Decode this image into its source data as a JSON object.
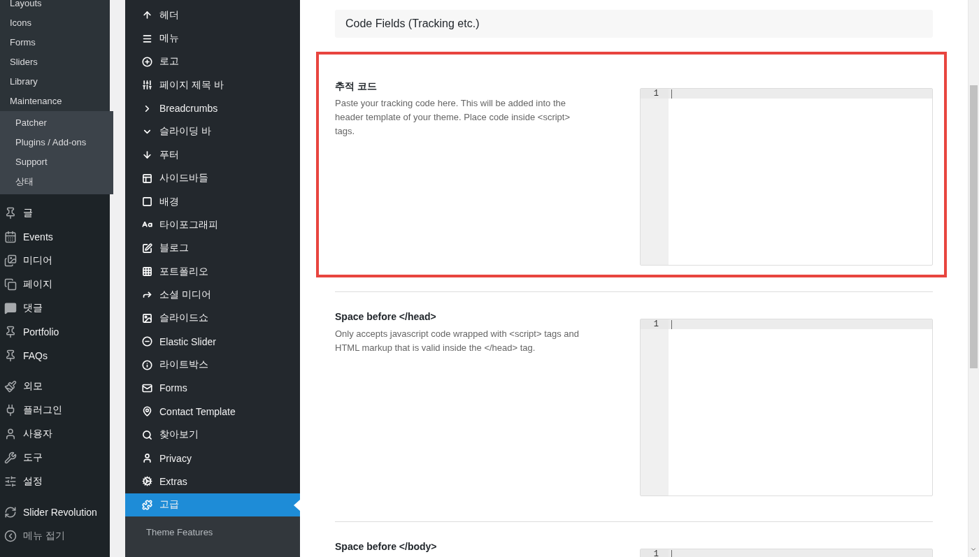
{
  "admin_menu": {
    "flyout_items": [
      "Layouts",
      "Icons",
      "Forms",
      "Sliders",
      "Library",
      "Maintenance"
    ],
    "submenu_items": [
      "Patcher",
      "Plugins / Add-ons",
      "Support",
      "상태"
    ],
    "groups": [
      [
        "글",
        "Events",
        "미디어",
        "페이지",
        "댓글",
        "Portfolio",
        "FAQs"
      ],
      [
        "외모",
        "플러그인",
        "사용자",
        "도구",
        "설정"
      ],
      [
        "Slider Revolution",
        "메뉴 접기"
      ]
    ]
  },
  "theme_nav": {
    "items": [
      {
        "label": "헤더",
        "selected": false
      },
      {
        "label": "메뉴",
        "selected": false
      },
      {
        "label": "로고",
        "selected": false
      },
      {
        "label": "페이지 제목 바",
        "selected": false
      },
      {
        "label": "Breadcrumbs",
        "selected": false
      },
      {
        "label": "슬라이딩 바",
        "selected": false
      },
      {
        "label": "푸터",
        "selected": false
      },
      {
        "label": "사이드바들",
        "selected": false
      },
      {
        "label": "배경",
        "selected": false
      },
      {
        "label": "타이포그래피",
        "selected": false
      },
      {
        "label": "블로그",
        "selected": false
      },
      {
        "label": "포트폴리오",
        "selected": false
      },
      {
        "label": "소셜 미디어",
        "selected": false
      },
      {
        "label": "슬라이드쇼",
        "selected": false
      },
      {
        "label": "Elastic Slider",
        "selected": false
      },
      {
        "label": "라이트박스",
        "selected": false
      },
      {
        "label": "Forms",
        "selected": false
      },
      {
        "label": "Contact Template",
        "selected": false
      },
      {
        "label": "찾아보기",
        "selected": false
      },
      {
        "label": "Privacy",
        "selected": false
      },
      {
        "label": "Extras",
        "selected": false
      },
      {
        "label": "고급",
        "selected": true
      }
    ],
    "subitems": [
      "Theme Features"
    ]
  },
  "content": {
    "section_title": "Code Fields (Tracking etc.)",
    "fields": [
      {
        "title": "추적 코드",
        "description": "Paste your tracking code here. This will be added into the header template of your theme. Place code inside <script> tags.",
        "line_number": "1",
        "highlighted": true
      },
      {
        "title": "Space before </head>",
        "description": "Only accepts javascript code wrapped with <script> tags and HTML markup that is valid inside the </head> tag.",
        "line_number": "1",
        "highlighted": false
      },
      {
        "title": "Space before </body>",
        "line_number": "1",
        "highlighted": false
      }
    ]
  }
}
